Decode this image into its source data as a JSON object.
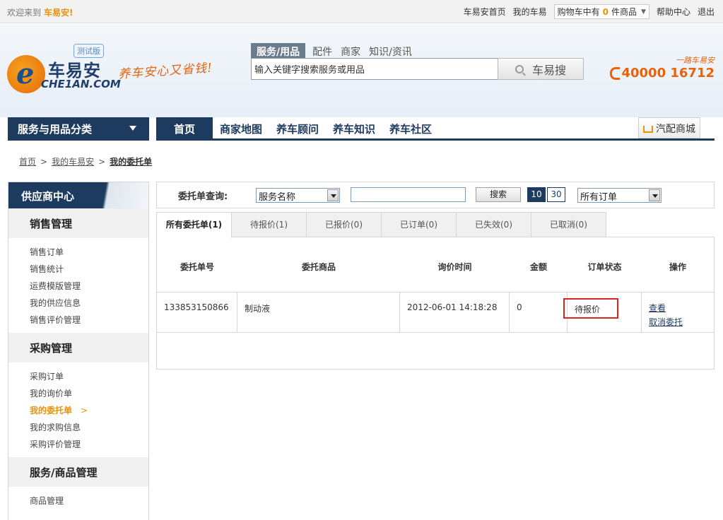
{
  "topbar": {
    "welcome": "欢迎来到",
    "brand": "车易安!",
    "links": [
      "车易安首页",
      "我的车易"
    ],
    "cart_prefix": "购物车中有",
    "cart_count": "0",
    "cart_suffix": "件商品",
    "help": "帮助中心",
    "logout": "退出"
  },
  "header": {
    "logo_letter": "e",
    "logo_cn": "车易安",
    "logo_en": "CHE1AN.COM",
    "beta": "测试版",
    "slogan": "养车安心又省钱!",
    "search_tabs": [
      "服务/用品",
      "配件",
      "商家",
      "知识/资讯"
    ],
    "search_value": "输入关键字搜索服务或用品",
    "search_button": "车易搜",
    "hotline_tag": "一路车易安",
    "hotline_number": "40000 16712"
  },
  "nav": {
    "category": "服务与用品分类",
    "items": [
      "首页",
      "商家地图",
      "养车顾问",
      "养车知识",
      "养车社区"
    ],
    "mall": "汽配商城"
  },
  "breadcrumb": [
    "首页",
    "我的车易安",
    "我的委托单"
  ],
  "sidebar": {
    "title": "供应商中心",
    "sections": [
      {
        "title": "销售管理",
        "items": [
          "销售订单",
          "销售统计",
          "运费模版管理",
          "我的供应信息",
          "销售评价管理"
        ]
      },
      {
        "title": "采购管理",
        "items": [
          "采购订单",
          "我的询价单",
          "我的委托单",
          "我的求购信息",
          "采购评价管理"
        ]
      },
      {
        "title": "服务/商品管理",
        "items": [
          "商品管理"
        ]
      }
    ],
    "active_item": "我的委托单",
    "active_chevron": ">"
  },
  "query": {
    "label": "委托单查询:",
    "field_select": "服务名称",
    "input_value": "",
    "search_button": "搜索",
    "page_sizes": [
      "10",
      "30"
    ],
    "page_size_selected": "10",
    "order_filter": "所有订单"
  },
  "order_tabs": [
    "所有委托单(1)",
    "待报价(1)",
    "已报价(0)",
    "已订单(0)",
    "已失效(0)",
    "已取消(0)"
  ],
  "table": {
    "headers": [
      "委托单号",
      "委托商品",
      "询价时间",
      "金额",
      "订单状态",
      "操作"
    ],
    "rows": [
      {
        "id": "133853150866",
        "product": "制动液",
        "time": "2012-06-01 14:18:28",
        "amount": "0",
        "status": "待报价",
        "actions": [
          "查看",
          "取消委托"
        ]
      }
    ]
  },
  "colors": {
    "brand_navy": "#1d3a5f",
    "accent_orange": "#e8920c",
    "highlight_red": "#d7261e"
  }
}
